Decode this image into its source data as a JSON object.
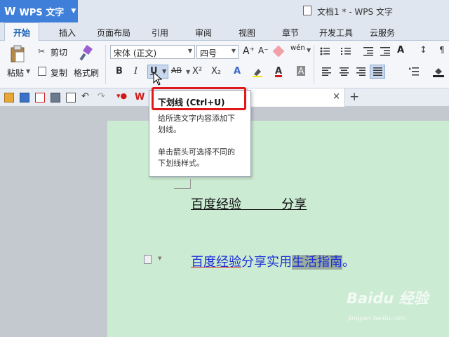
{
  "app": {
    "name": "WPS 文字",
    "logo": "W",
    "doc_title": "文档1 * - WPS 文字"
  },
  "menu_tabs": [
    "开始",
    "插入",
    "页面布局",
    "引用",
    "审阅",
    "视图",
    "章节",
    "开发工具",
    "云服务"
  ],
  "ribbon": {
    "paste": "粘贴",
    "cut": "剪切",
    "copy": "复制",
    "format_painter": "格式刷",
    "font_name": "宋体 (正文)",
    "font_size": "四号",
    "bold": "B",
    "italic": "I",
    "underline": "U",
    "strike": "AB",
    "superscript": "X²",
    "subscript": "X₂",
    "font_color_letter": "A",
    "char_border": "A",
    "grow": "A⁺",
    "shrink": "A⁻",
    "pinyin": "wén"
  },
  "tooltip": {
    "title": "下划线 (Ctrl+U)",
    "desc1_line1": "给所选文字内容添加下",
    "desc1_line2": "划线。",
    "desc2_line1": "单击箭头可选择不同的",
    "desc2_line2": "下划线样式。"
  },
  "document": {
    "line1": "百度经验          分享",
    "line2_part1": "百度经验",
    "line2_part2": "分享实用",
    "line2_part3": "生活指南",
    "line2_part4": "。"
  },
  "watermark": {
    "text": "Baidu 经验",
    "sub": "jingyan.baidu.com"
  },
  "colors": {
    "accent": "#3f7fd9",
    "page_bg": "#ccebd3",
    "highlight_red": "#e01818",
    "doc_text_blue": "#1b2fd6"
  }
}
